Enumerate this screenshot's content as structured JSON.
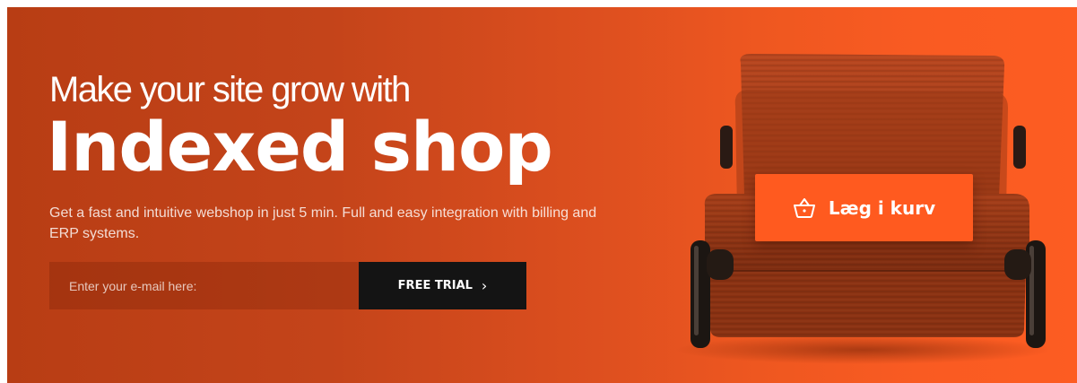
{
  "hero": {
    "headline_small": "Make your site grow with",
    "headline_big": "Indexed shop",
    "subtext": "Get a fast and intuitive webshop in just 5 min. Full and easy integration with billing and ERP systems.",
    "email_placeholder": "Enter your e-mail here:",
    "trial_label": "FREE TRIAL",
    "trial_icon": "chevron-right-icon"
  },
  "product": {
    "image": "orange corduroy sofa bed",
    "cart_label": "Læg i kurv",
    "cart_icon": "shopping-basket-icon"
  },
  "colors": {
    "background_dark": "#b83d14",
    "background_bright": "#fd5c22",
    "button_dark": "#141414",
    "cart_button": "#ff5a1f",
    "text": "#ffffff"
  }
}
